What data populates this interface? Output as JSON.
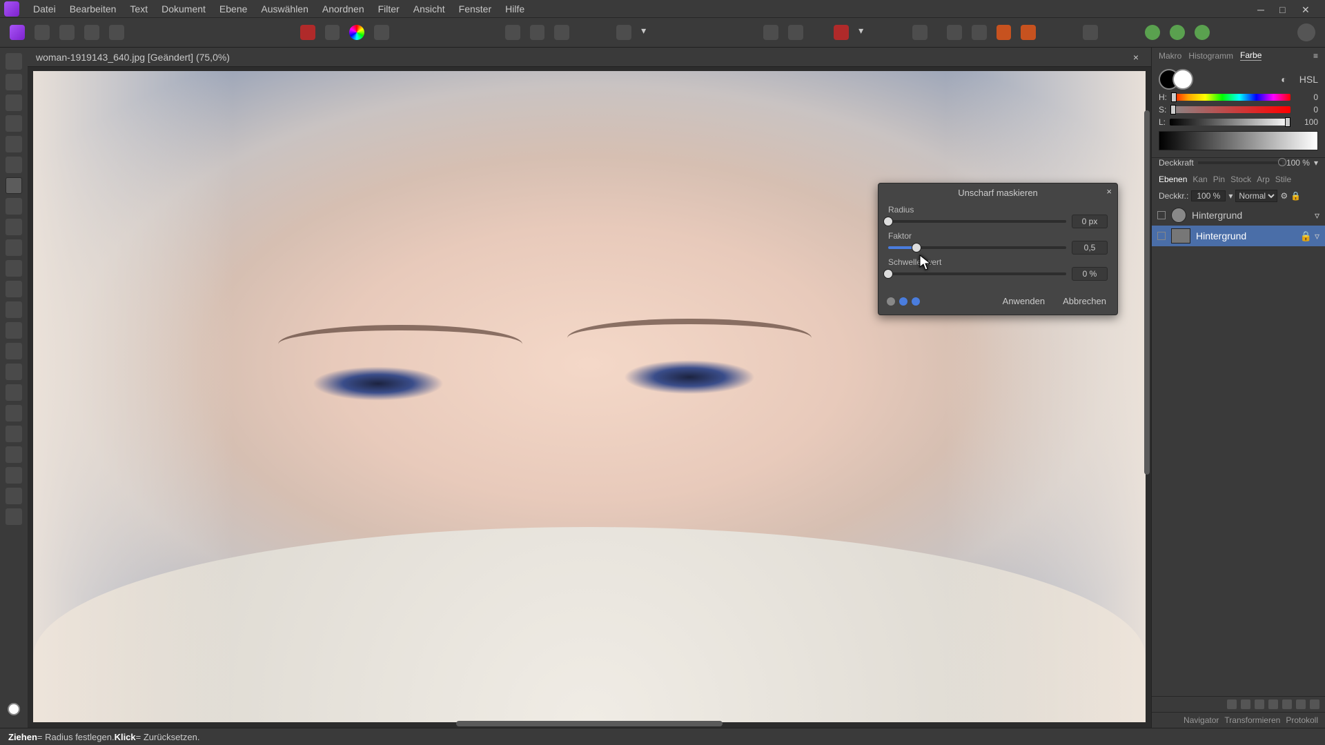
{
  "menu": {
    "items": [
      "Datei",
      "Bearbeiten",
      "Text",
      "Dokument",
      "Ebene",
      "Auswählen",
      "Anordnen",
      "Filter",
      "Ansicht",
      "Fenster",
      "Hilfe"
    ]
  },
  "document": {
    "tab_label": "woman-1919143_640.jpg [Geändert] (75,0%)"
  },
  "dialog": {
    "title": "Unscharf maskieren",
    "close": "×",
    "radius": {
      "label": "Radius",
      "value": "0 px",
      "pct": 0
    },
    "factor": {
      "label": "Faktor",
      "value": "0,5",
      "pct": 16
    },
    "threshold": {
      "label": "Schwellenwert",
      "value": "0 %",
      "pct": 0
    },
    "apply": "Anwenden",
    "cancel": "Abbrechen"
  },
  "panels": {
    "top_tabs": [
      "Makro",
      "Histogramm",
      "Farbe"
    ],
    "top_active": "Farbe",
    "color": {
      "mode": "HSL",
      "h": {
        "label": "H:",
        "value": "0"
      },
      "s": {
        "label": "S:",
        "value": "0"
      },
      "l": {
        "label": "L:",
        "value": "100"
      }
    },
    "opacity": {
      "label": "Deckkraft",
      "value": "100 %"
    },
    "layer_tabs": [
      "Ebenen",
      "Kan",
      "Pin",
      "Stock",
      "Arp",
      "Stile"
    ],
    "layer_controls": {
      "label": "Deckkr.:",
      "pct": "100 %",
      "blend": "Normal"
    },
    "layers": [
      {
        "name": "Hintergrund",
        "selected": false,
        "circ": true
      },
      {
        "name": "Hintergrund",
        "selected": true,
        "circ": false
      }
    ],
    "bottom_tabs": [
      "Navigator",
      "Transformieren",
      "Protokoll"
    ]
  },
  "status": {
    "drag": "Ziehen",
    "drag_txt": " = Radius festlegen. ",
    "click": "Klick",
    "click_txt": " = Zurücksetzen."
  }
}
